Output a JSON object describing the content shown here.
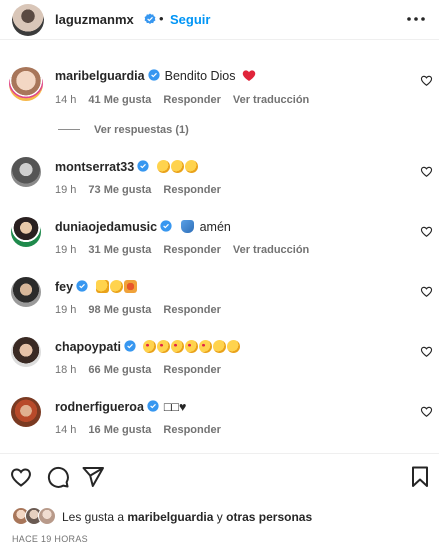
{
  "header": {
    "username": "laguzmanmx",
    "separator": "•",
    "follow_label": "Seguir"
  },
  "comments": [
    {
      "user": "maribelguardia",
      "text": "Bendito Dios",
      "emojis": [
        "red-heart"
      ],
      "time": "14 h",
      "likes": "41 Me gusta",
      "reply": "Responder",
      "translate": "Ver traducción"
    },
    {
      "user": "montserrat33",
      "text": "",
      "emojis": [
        "clapping-hands",
        "clapping-hands",
        "clapping-hands"
      ],
      "time": "19 h",
      "likes": "73 Me gusta",
      "reply": "Responder"
    },
    {
      "user": "duniaojedamusic",
      "text": "amén",
      "emojis": [
        "folded-hands"
      ],
      "time": "19 h",
      "likes": "31 Me gusta",
      "reply": "Responder",
      "translate": "Ver traducción"
    },
    {
      "user": "fey",
      "text": "",
      "emojis": [
        "raising-hands",
        "clapping-hands",
        "collision"
      ],
      "time": "19 h",
      "likes": "98 Me gusta",
      "reply": "Responder"
    },
    {
      "user": "chapoypati",
      "text": "",
      "emojis": [
        "heart-eyes",
        "heart-eyes",
        "heart-eyes",
        "heart-eyes",
        "heart-eyes",
        "clapping-hands",
        "clapping-hands"
      ],
      "time": "18 h",
      "likes": "66 Me gusta",
      "reply": "Responder"
    },
    {
      "user": "rodnerfigueroa",
      "text": "□□♥",
      "emojis": [],
      "time": "14 h",
      "likes": "16 Me gusta",
      "reply": "Responder"
    }
  ],
  "replies_label": "Ver respuestas (1)",
  "likes_line": {
    "prefix": "Les gusta a",
    "user": "maribelguardia",
    "middle": "y",
    "others": "otras personas"
  },
  "timestamp": "HACE 19 HORAS",
  "colors": {
    "accent": "#0095f6",
    "verified": "#3797f0",
    "muted": "#737373",
    "heart": "#ed2b45"
  }
}
